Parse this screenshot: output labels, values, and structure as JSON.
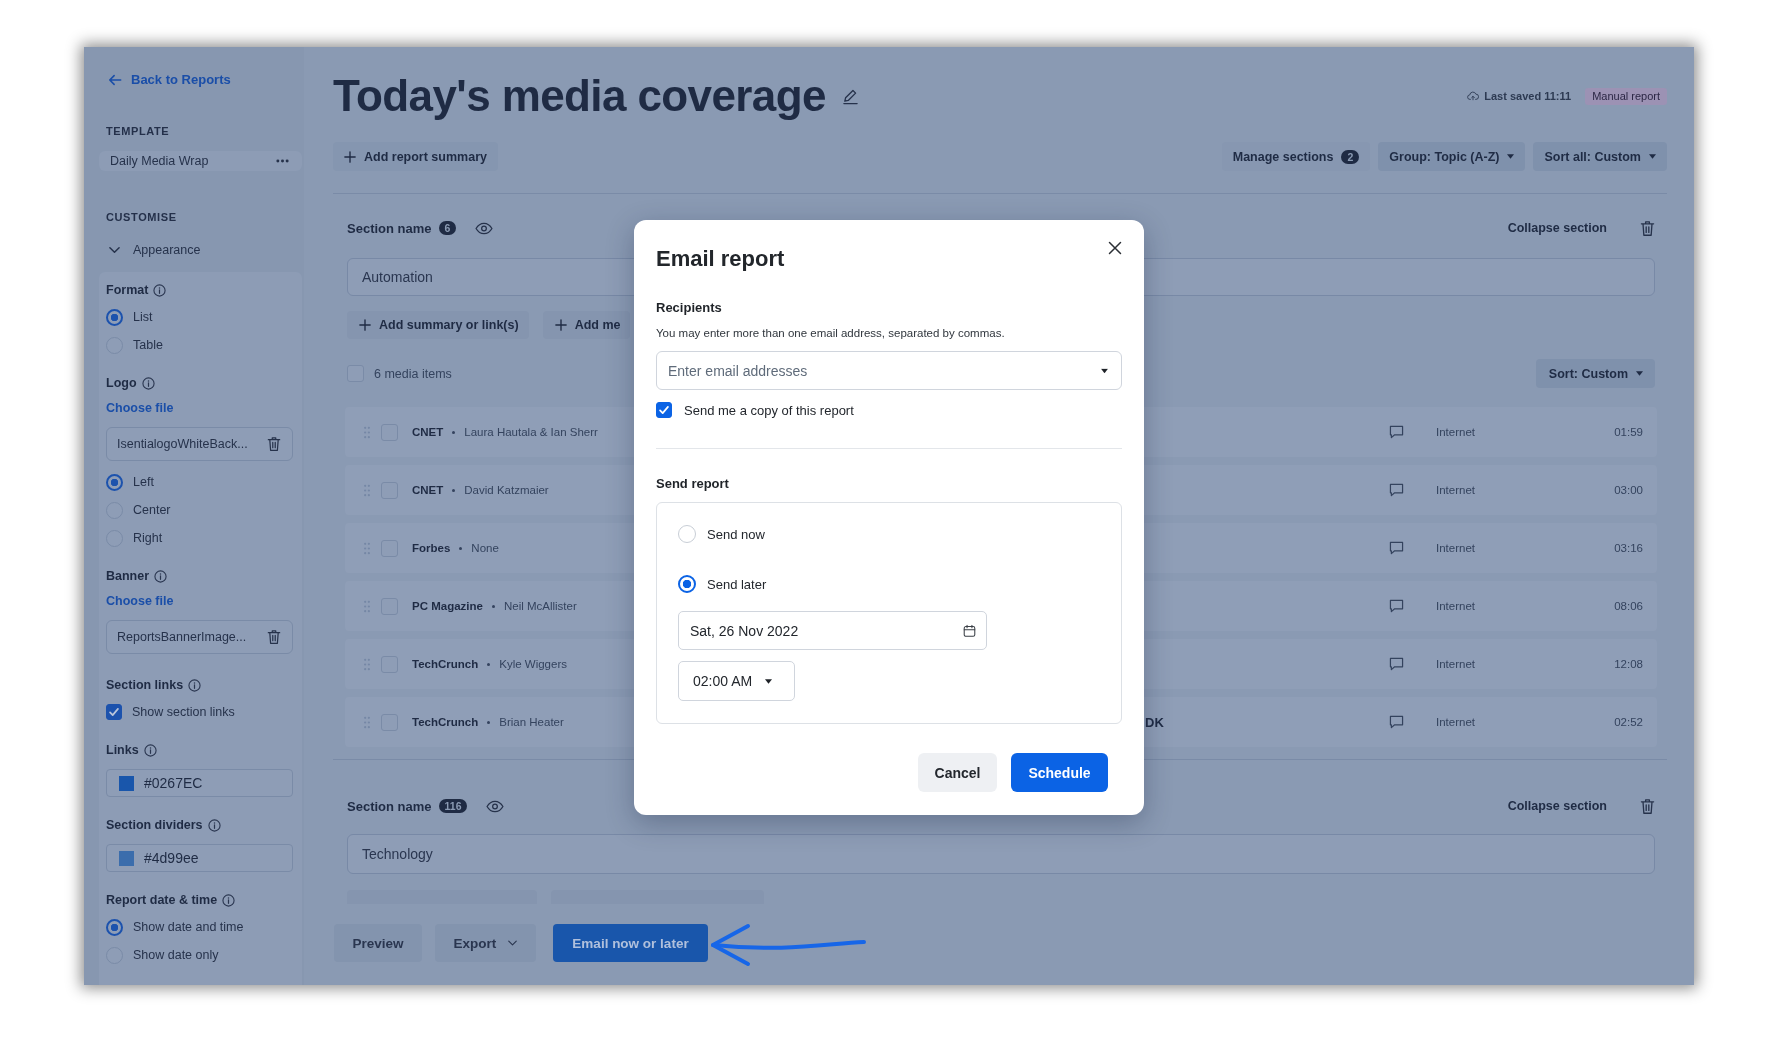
{
  "sidebar": {
    "back_link": "Back to Reports",
    "template": {
      "heading": "TEMPLATE",
      "name": "Daily Media Wrap"
    },
    "customise": {
      "heading": "CUSTOMISE",
      "group": "Appearance",
      "expanded": true
    },
    "settings": [
      {
        "label": "Format",
        "controls": [
          {
            "kind": "radio",
            "label": "List",
            "selected": true
          },
          {
            "kind": "radio",
            "label": "Table",
            "selected": false
          }
        ]
      },
      {
        "label": "Logo",
        "controls": [
          {
            "kind": "link",
            "label": "Choose file"
          },
          {
            "kind": "file",
            "label": "IsentialogoWhiteBack..."
          },
          {
            "kind": "radio",
            "label": "Left",
            "selected": true
          },
          {
            "kind": "radio",
            "label": "Center",
            "selected": false
          },
          {
            "kind": "radio",
            "label": "Right",
            "selected": false
          }
        ]
      },
      {
        "label": "Banner",
        "controls": [
          {
            "kind": "link",
            "label": "Choose file"
          },
          {
            "kind": "file",
            "label": "ReportsBannerImage..."
          }
        ]
      },
      {
        "label": "Section links",
        "controls": [
          {
            "kind": "checkbox",
            "label": "Show section links",
            "checked": true
          }
        ]
      },
      {
        "label": "Links",
        "controls": [
          {
            "kind": "color",
            "label": "#0267EC"
          }
        ]
      },
      {
        "label": "Section dividers",
        "controls": [
          {
            "kind": "color",
            "label": "#4d99ee"
          }
        ]
      },
      {
        "label": "Report date & time",
        "controls": [
          {
            "kind": "radio",
            "label": "Show date and time",
            "selected": true
          },
          {
            "kind": "radio",
            "label": "Show date only",
            "selected": false
          }
        ]
      }
    ]
  },
  "header": {
    "title": "Today's media coverage",
    "last_saved": "Last saved 11:11",
    "badge": "Manual report"
  },
  "toolbar": {
    "add_summary": "Add report summary",
    "manage_sections": {
      "label": "Manage sections",
      "count": "2"
    },
    "group": "Group: Topic (A-Z)",
    "sort_all": "Sort all: Custom"
  },
  "sections": [
    {
      "label": "Section name",
      "count": "6",
      "collapse": "Collapse section",
      "name": "Automation",
      "actions": [
        "Add summary or link(s)",
        "Add me"
      ],
      "select_all": {
        "label": "6 media items",
        "checked": false
      },
      "sort": "Sort: Custom",
      "items": [
        {
          "outlet": "CNET",
          "author": "Laura Hautala & Ian Sherr",
          "checked": false,
          "medium": "Internet",
          "duration": "01:59"
        },
        {
          "outlet": "CNET",
          "author": "David Katzmaier",
          "checked": false,
          "medium": "Internet",
          "duration": "03:00"
        },
        {
          "outlet": "Forbes",
          "author": "None",
          "checked": false,
          "medium": "Internet",
          "duration": "03:16"
        },
        {
          "outlet": "PC Magazine",
          "author": "Neil McAllister",
          "checked": false,
          "medium": "Internet",
          "duration": "08:06"
        },
        {
          "outlet": "TechCrunch",
          "author": "Kyle Wiggers",
          "checked": false,
          "medium": "Internet",
          "duration": "12:08"
        },
        {
          "outlet": "TechCrunch",
          "author": "Brian Heater",
          "headline": "DK",
          "checked": false,
          "medium": "Internet",
          "duration": "02:52"
        }
      ]
    },
    {
      "label": "Section name",
      "count": "116",
      "collapse": "Collapse section",
      "name": "Technology"
    }
  ],
  "footer": {
    "buttons": [
      {
        "label": "Preview",
        "kind": "plain"
      },
      {
        "label": "Export",
        "kind": "menu"
      },
      {
        "label": "Email now or later",
        "kind": "primary"
      }
    ]
  },
  "modal": {
    "title": "Email report",
    "recipients": {
      "heading": "Recipients",
      "hint": "You may enter more than one email address, separated by commas.",
      "placeholder": "Enter email addresses"
    },
    "copy": {
      "label": "Send me a copy of this report",
      "checked": true
    },
    "send": {
      "heading": "Send report",
      "options": [
        {
          "label": "Send now",
          "selected": false
        },
        {
          "label": "Send later",
          "selected": true
        }
      ],
      "date": "Sat, 26 Nov 2022",
      "time": "02:00 AM"
    },
    "buttons": [
      {
        "label": "Cancel",
        "kind": "secondary"
      },
      {
        "label": "Schedule",
        "kind": "primary"
      }
    ]
  }
}
